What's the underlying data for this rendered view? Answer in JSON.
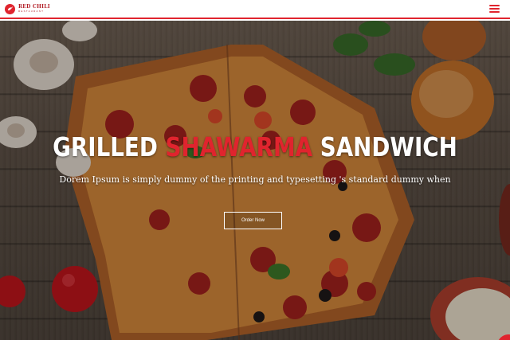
{
  "brand": {
    "name": "RED CHILI",
    "tagline": "RESTAURANT",
    "icon": "chili-logo-icon",
    "color": "#e0242e"
  },
  "nav": {
    "menu_icon": "hamburger-menu-icon"
  },
  "hero": {
    "title_part1": "GRILLED",
    "title_accent": "SHAWARMA",
    "title_part3": "SANDWICH",
    "subtitle": "Dorem Ipsum is simply dummy of the printing and typesetting 's standard dummy when",
    "cta_label": "Order Now",
    "accent_color": "#e0242e"
  }
}
